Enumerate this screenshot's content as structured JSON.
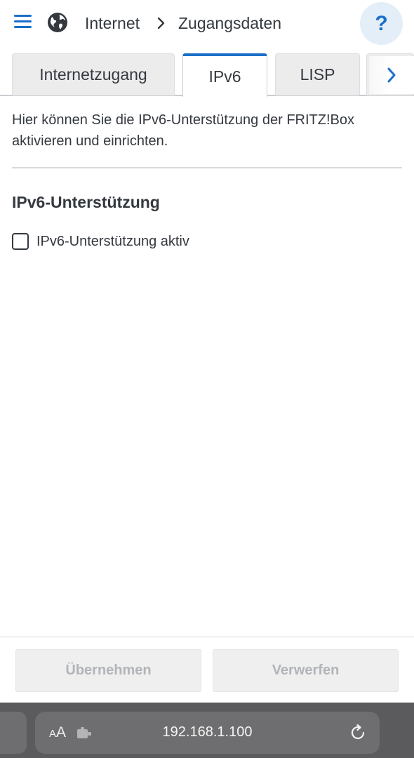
{
  "header": {
    "breadcrumb": [
      "Internet",
      "Zugangsdaten"
    ],
    "help_label": "?"
  },
  "tabs": [
    {
      "label": "Internetzugang",
      "active": false
    },
    {
      "label": "IPv6",
      "active": true
    },
    {
      "label": "LISP",
      "active": false
    }
  ],
  "content": {
    "intro": "Hier können Sie die IPv6-Unterstützung der FRITZ!Box aktivieren und einrichten.",
    "section_title": "IPv6-Unterstützung",
    "checkbox_label": "IPv6-Unterstützung aktiv",
    "checkbox_checked": false
  },
  "footer": {
    "apply_label": "Übernehmen",
    "discard_label": "Verwerfen"
  },
  "browser": {
    "text_size_small": "A",
    "text_size_big": "A",
    "url": "192.168.1.100"
  },
  "colors": {
    "accent": "#1b6fc9",
    "text": "#34393f",
    "disabled_text": "#b1b4b8",
    "browser_bar": "#5b5b5d"
  }
}
